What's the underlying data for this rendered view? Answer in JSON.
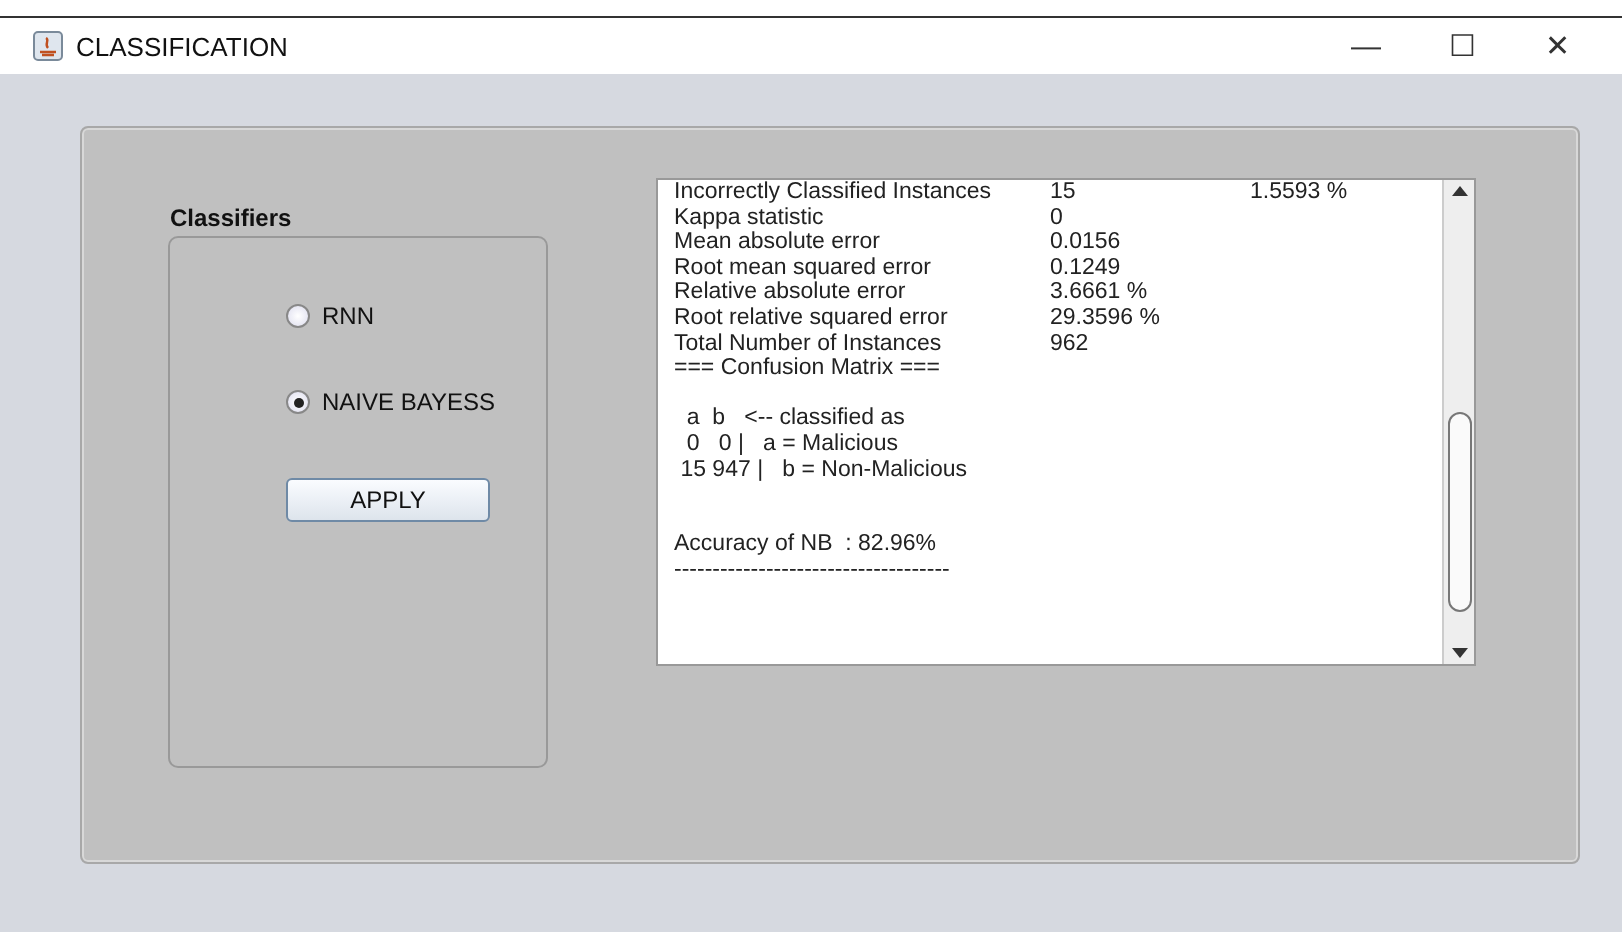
{
  "window": {
    "title": "CLASSIFICATION",
    "controls": [
      "—",
      "☐",
      "✕"
    ]
  },
  "classifiers": {
    "title": "Classifiers",
    "options": [
      {
        "label": "RNN",
        "selected": false
      },
      {
        "label": "NAIVE BAYESS",
        "selected": true
      }
    ],
    "button": "APPLY"
  },
  "output": {
    "lines": [
      {
        "kind": "stat",
        "label": "Incorrectly Classified Instances",
        "value": "15",
        "extra": "1.5593 %"
      },
      {
        "kind": "stat",
        "label": "Kappa statistic",
        "value": "0"
      },
      {
        "kind": "stat",
        "label": "Mean absolute error",
        "value": "0.0156"
      },
      {
        "kind": "stat",
        "label": "Root mean squared error",
        "value": "0.1249"
      },
      {
        "kind": "stat",
        "label": "Relative absolute error",
        "value": "3.6661 %"
      },
      {
        "kind": "stat",
        "label": "Root relative squared error",
        "value": "29.3596 %"
      },
      {
        "kind": "stat",
        "label": "Total Number of Instances",
        "value": "962"
      },
      {
        "kind": "text",
        "text": "=== Confusion Matrix ==="
      },
      {
        "kind": "blank"
      },
      {
        "kind": "text",
        "text": "  a  b   <-- classified as"
      },
      {
        "kind": "text",
        "text": "  0   0 |   a = Malicious"
      },
      {
        "kind": "text",
        "text": " 15 947 |   b = Non-Malicious"
      },
      {
        "kind": "blank"
      },
      {
        "kind": "blank"
      },
      {
        "kind": "text",
        "text": "Accuracy of NB  : 82.96%"
      },
      {
        "kind": "text",
        "text": "------------------------------------"
      }
    ]
  }
}
